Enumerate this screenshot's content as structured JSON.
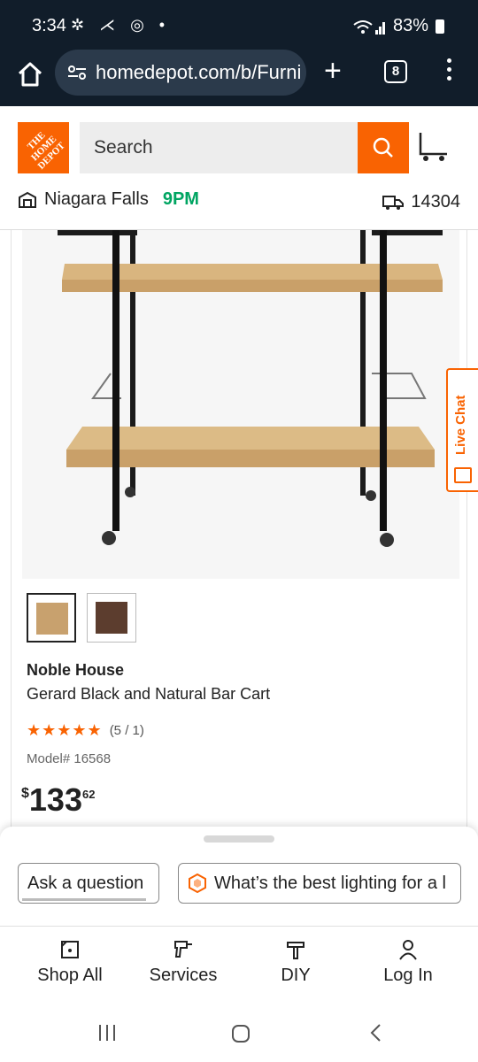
{
  "status_bar": {
    "time": "3:34",
    "left_icons": "✲ ⋌ ◎ •",
    "battery": "83%"
  },
  "browser": {
    "url": "homedepot.com/b/Furni",
    "tab_count": "8"
  },
  "header": {
    "logo_text": "THE HOME DEPOT",
    "search_placeholder": "Search",
    "store_name": "Niagara Falls",
    "store_hours": "9PM",
    "zip": "14304"
  },
  "product": {
    "brand": "Noble House",
    "title": "Gerard Black and Natural Bar Cart",
    "stars": "★★★★★",
    "rating_text": "(5 / 1)",
    "model": "Model# 16568",
    "price_currency": "$",
    "price_dollars": "133",
    "price_cents": "62",
    "swatches": [
      {
        "color": "#c8a16e",
        "selected": true
      },
      {
        "color": "#5c3d2e",
        "selected": false
      }
    ]
  },
  "live_chat": {
    "label": "Live Chat"
  },
  "sheet": {
    "chip1": "Ask a question",
    "chip2": "What’s the best lighting for a l"
  },
  "nav": [
    {
      "label": "Shop All",
      "icon": "tag-icon"
    },
    {
      "label": "Services",
      "icon": "drill-icon"
    },
    {
      "label": "DIY",
      "icon": "hammer-icon"
    },
    {
      "label": "Log In",
      "icon": "user-icon"
    }
  ],
  "colors": {
    "brand_orange": "#f96302",
    "open_green": "#00a562",
    "dark_bar": "#111d2a"
  }
}
